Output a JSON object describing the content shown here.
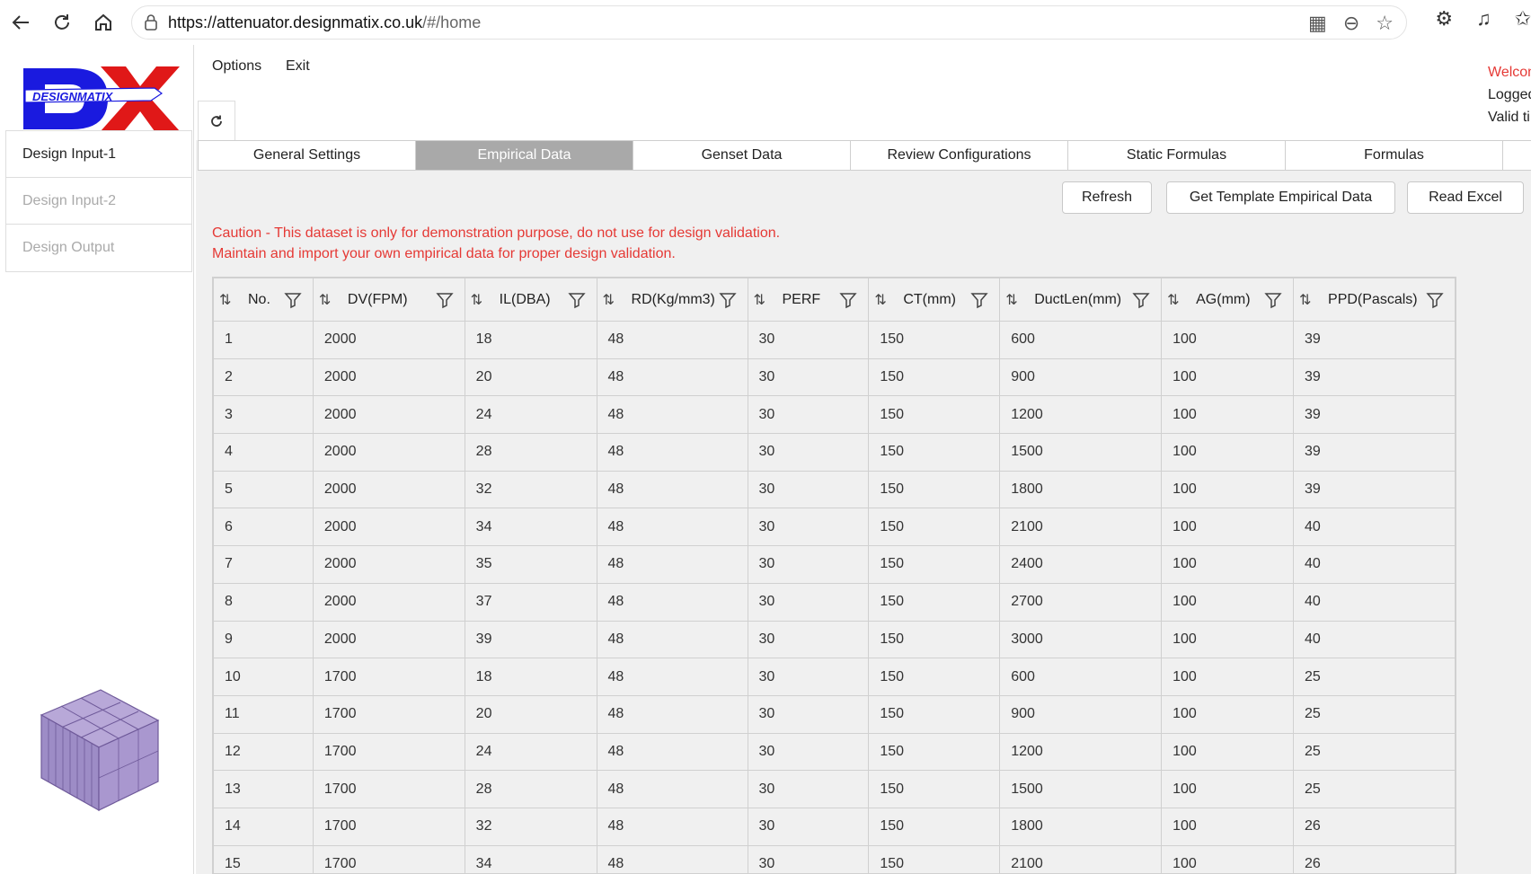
{
  "browser": {
    "url_host": "https://attenuator.designmatix.co.uk",
    "url_path": "/#/home"
  },
  "app": {
    "logo_text": "DESIGNMATIX",
    "menu": {
      "options": "Options",
      "exit": "Exit"
    },
    "user_panel": {
      "line1": "Welcome",
      "line2": "Logged",
      "line3": "Valid ti"
    },
    "sidebar": [
      {
        "label": "Design Input-1",
        "state": "active"
      },
      {
        "label": "Design Input-2",
        "state": "disabled"
      },
      {
        "label": "Design Output",
        "state": "disabled"
      }
    ],
    "tabs": [
      "General Settings",
      "Empirical Data",
      "Genset Data",
      "Review Configurations",
      "Static Formulas",
      "Formulas"
    ],
    "active_tab": "Empirical Data",
    "buttons": {
      "refresh": "Refresh",
      "template": "Get Template Empirical Data",
      "read_excel": "Read Excel"
    },
    "caution": {
      "line1": "Caution - This dataset is only for demonstration purpose, do not use for design validation.",
      "line2": "Maintain and import your own empirical data for proper design validation."
    },
    "table": {
      "columns": [
        "No.",
        "DV(FPM)",
        "IL(DBA)",
        "RD(Kg/mm3)",
        "PERF",
        "CT(mm)",
        "DuctLen(mm)",
        "AG(mm)",
        "PPD(Pascals)"
      ],
      "rows": [
        [
          "1",
          "2000",
          "18",
          "48",
          "30",
          "150",
          "600",
          "100",
          "39"
        ],
        [
          "2",
          "2000",
          "20",
          "48",
          "30",
          "150",
          "900",
          "100",
          "39"
        ],
        [
          "3",
          "2000",
          "24",
          "48",
          "30",
          "150",
          "1200",
          "100",
          "39"
        ],
        [
          "4",
          "2000",
          "28",
          "48",
          "30",
          "150",
          "1500",
          "100",
          "39"
        ],
        [
          "5",
          "2000",
          "32",
          "48",
          "30",
          "150",
          "1800",
          "100",
          "39"
        ],
        [
          "6",
          "2000",
          "34",
          "48",
          "30",
          "150",
          "2100",
          "100",
          "40"
        ],
        [
          "7",
          "2000",
          "35",
          "48",
          "30",
          "150",
          "2400",
          "100",
          "40"
        ],
        [
          "8",
          "2000",
          "37",
          "48",
          "30",
          "150",
          "2700",
          "100",
          "40"
        ],
        [
          "9",
          "2000",
          "39",
          "48",
          "30",
          "150",
          "3000",
          "100",
          "40"
        ],
        [
          "10",
          "1700",
          "18",
          "48",
          "30",
          "150",
          "600",
          "100",
          "25"
        ],
        [
          "11",
          "1700",
          "20",
          "48",
          "30",
          "150",
          "900",
          "100",
          "25"
        ],
        [
          "12",
          "1700",
          "24",
          "48",
          "30",
          "150",
          "1200",
          "100",
          "25"
        ],
        [
          "13",
          "1700",
          "28",
          "48",
          "30",
          "150",
          "1500",
          "100",
          "25"
        ],
        [
          "14",
          "1700",
          "32",
          "48",
          "30",
          "150",
          "1800",
          "100",
          "26"
        ],
        [
          "15",
          "1700",
          "34",
          "48",
          "30",
          "150",
          "2100",
          "100",
          "26"
        ]
      ]
    }
  },
  "colors": {
    "accent_red": "#e53935",
    "active_tab": "#a9a9a9",
    "logo_blue": "#1a1adf",
    "logo_red": "#e01818"
  }
}
